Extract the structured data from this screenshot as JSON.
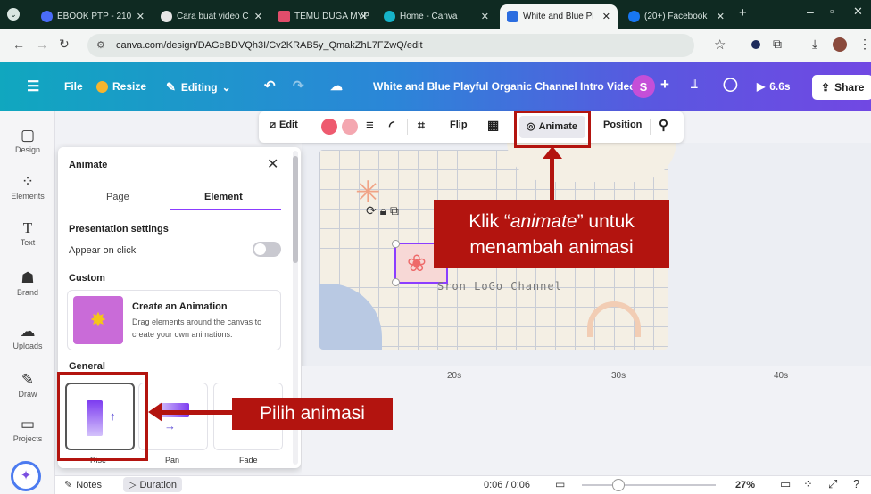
{
  "browser": {
    "tabs": [
      {
        "label": "EBOOK PTP - 210",
        "color": "#4a6cf7"
      },
      {
        "label": "Cara buat video C",
        "color": "#333333"
      },
      {
        "label": "TEMU DUGA MYP",
        "color": "#e04d6b"
      },
      {
        "label": "Home - Canva",
        "color": "#16b3c9"
      },
      {
        "label": "White and Blue Pl",
        "color": "#2b6de0"
      },
      {
        "label": "(20+) Facebook",
        "color": "#1877f2"
      }
    ],
    "url": "canva.com/design/DAGeBDVQh3I/Cv2KRAB5y_QmakZhL7FZwQ/edit"
  },
  "header": {
    "file": "File",
    "resize": "Resize",
    "editing": "Editing",
    "title": "White and Blue Playful Organic Channel Intro Video",
    "avatar": "S",
    "duration": "6.6s",
    "share": "Share"
  },
  "sidebar": [
    {
      "label": "Design",
      "icon": "design-icon"
    },
    {
      "label": "Elements",
      "icon": "elements-icon"
    },
    {
      "label": "Text",
      "icon": "text-icon"
    },
    {
      "label": "Brand",
      "icon": "brand-icon"
    },
    {
      "label": "Uploads",
      "icon": "uploads-icon"
    },
    {
      "label": "Draw",
      "icon": "draw-icon"
    },
    {
      "label": "Projects",
      "icon": "projects-icon"
    }
  ],
  "toolbar": {
    "edit": "Edit",
    "flip": "Flip",
    "animate": "Animate",
    "position": "Position",
    "colors": [
      "#ee5a6f",
      "#f4a7b0"
    ]
  },
  "panel": {
    "title": "Animate",
    "tabs": [
      "Page",
      "Element"
    ],
    "presentation_settings": "Presentation settings",
    "appear_on_click": "Appear on click",
    "custom": "Custom",
    "create_title": "Create an Animation",
    "create_desc_1": "Drag elements around the canvas to",
    "create_desc_2": "create your own animations.",
    "general": "General",
    "animations": [
      "Rise",
      "Pan",
      "Fade"
    ]
  },
  "canvas": {
    "element_text": "Sron LoGo Channel"
  },
  "timeline": {
    "marks": [
      "20s",
      "30s",
      "40s"
    ]
  },
  "bottombar": {
    "notes": "Notes",
    "duration": "Duration",
    "time": "0:06 / 0:06",
    "zoom": "27%"
  },
  "annotations": {
    "animate_callout_line1_pre": "Klik “",
    "animate_callout_em": "animate",
    "animate_callout_line1_post": "” untuk",
    "animate_callout_line2": "menambah animasi",
    "choose_callout": "Pilih animasi"
  }
}
